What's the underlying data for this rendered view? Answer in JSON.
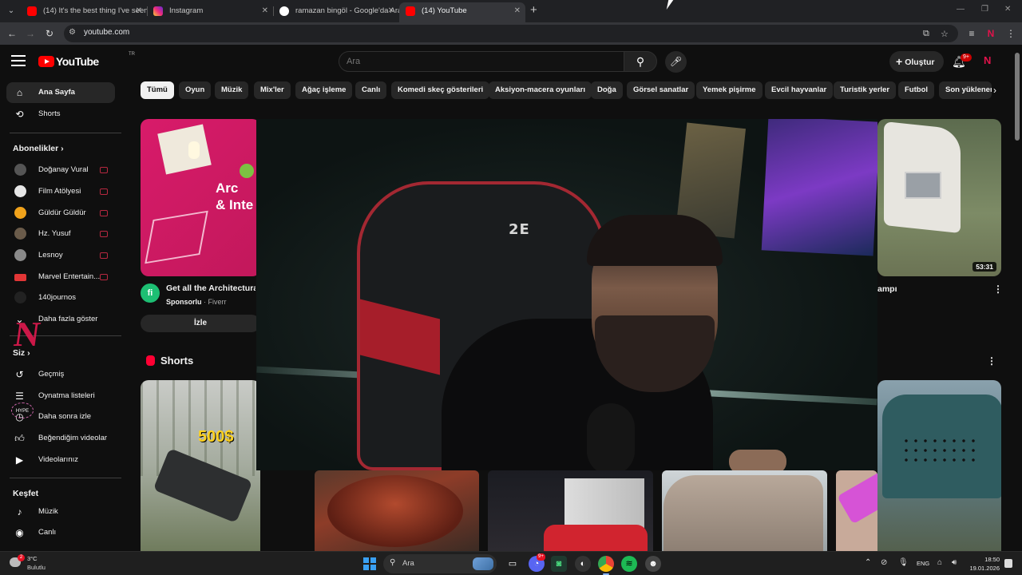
{
  "browser": {
    "tabs": [
      {
        "title": "(14) It's the best thing I've seen",
        "active": false,
        "favicon": "youtube-icon"
      },
      {
        "title": "Instagram",
        "active": false,
        "favicon": "instagram-icon"
      },
      {
        "title": "ramazan bingöl - Google'da Ara",
        "active": false,
        "favicon": "google-icon"
      },
      {
        "title": "(14) YouTube",
        "active": true,
        "favicon": "youtube-icon"
      }
    ],
    "url": "youtube.com",
    "colors": {
      "tab_bar": "#202124",
      "active_tab": "#35363a"
    }
  },
  "header": {
    "logo_text": "YouTube",
    "country_code": "TR",
    "search_placeholder": "Ara",
    "create_label": "Oluştur",
    "notification_count": "9+",
    "colors": {
      "brand": "#ff0000",
      "background": "#0f0f0f"
    }
  },
  "sidebar": {
    "primary": [
      {
        "label": "Ana Sayfa",
        "icon": "home-icon",
        "active": true
      },
      {
        "label": "Shorts",
        "icon": "shorts-icon",
        "active": false
      }
    ],
    "subscriptions_heading": "Abonelikler",
    "subscriptions": [
      {
        "label": "Doğanay Vural",
        "color": "#555555"
      },
      {
        "label": "Film Atölyesi",
        "color": "#e6e6e6"
      },
      {
        "label": "Güldür Güldür",
        "color": "#f0a21b"
      },
      {
        "label": "Hz. Yusuf",
        "color": "#6a5b4a"
      },
      {
        "label": "Lesnoy",
        "color": "#8a8a8a"
      },
      {
        "label": "Marvel Entertain...",
        "color": "#e23636"
      },
      {
        "label": "140journos",
        "color": "#222222"
      }
    ],
    "show_more": "Daha fazla göster",
    "you_heading": "Siz",
    "you_items": [
      {
        "label": "Geçmiş",
        "icon": "history-icon"
      },
      {
        "label": "Oynatma listeleri",
        "icon": "playlist-icon"
      },
      {
        "label": "Daha sonra izle",
        "icon": "watch-later-icon"
      },
      {
        "label": "Beğendiğim videolar",
        "icon": "like-icon"
      },
      {
        "label": "Videolarınız",
        "icon": "your-videos-icon"
      }
    ],
    "explore_heading": "Keşfet",
    "explore_items": [
      {
        "label": "Müzik",
        "icon": "music-icon"
      },
      {
        "label": "Canlı",
        "icon": "live-icon"
      }
    ]
  },
  "chips": [
    "Tümü",
    "Oyun",
    "Müzik",
    "Mix'ler",
    "Ağaç işleme",
    "Canlı",
    "Komedi skeç gösterileri",
    "Aksiyon-macera oyunları",
    "Doğa",
    "Görsel sanatlar",
    "Yemek pişirme",
    "Evcil hayvanlar",
    "Turistik yerler",
    "Futbol",
    "Son yüklenen"
  ],
  "ad": {
    "thumb_text": "Arc\n& Inte",
    "title": "Get all the Architectural",
    "sponsored": "Sponsorlu",
    "advertiser": "Fiverr",
    "button": "İzle",
    "channel_initial": "fi"
  },
  "video_right": {
    "duration": "53:31",
    "title_fragment": "ampı"
  },
  "shorts": {
    "heading": "Shorts",
    "first_thumb_text": "500$"
  },
  "overlay": {
    "channel_logo_text": "N",
    "hype_badge": "HYPE"
  },
  "taskbar": {
    "weather_temp": "3°C",
    "weather_desc": "Bulutlu",
    "weather_badge": "2",
    "search_text": "Ara",
    "language": "ENG",
    "time": "18:50",
    "date": "19.01.2026",
    "app_badge": "9+"
  }
}
